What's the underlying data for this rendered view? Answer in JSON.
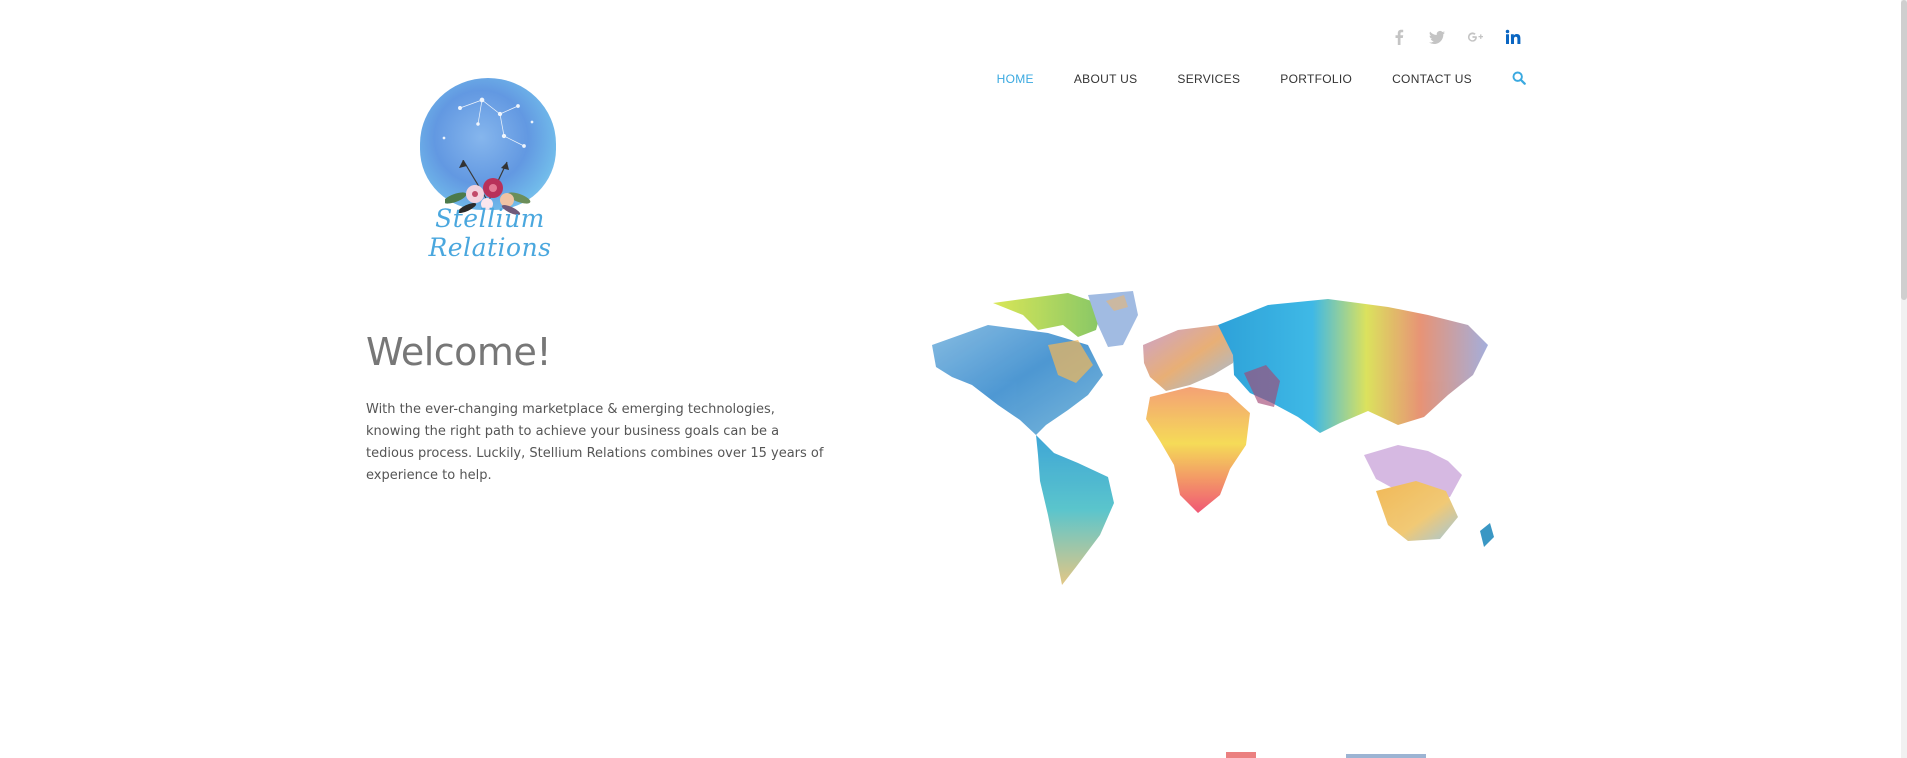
{
  "social": {
    "icons": [
      "facebook-icon",
      "twitter-icon",
      "google-plus-icon",
      "linkedin-icon"
    ],
    "linkedin_color": "#0a66c2",
    "muted_color": "#c4c4c4"
  },
  "nav": {
    "items": [
      {
        "label": "HOME",
        "active": true
      },
      {
        "label": "ABOUT US",
        "active": false
      },
      {
        "label": "SERVICES",
        "active": false
      },
      {
        "label": "PORTFOLIO",
        "active": false
      },
      {
        "label": "CONTACT US",
        "active": false
      }
    ],
    "accent_color": "#3aa9e0",
    "search_icon": "search-icon"
  },
  "logo": {
    "text": "Stellium Relations"
  },
  "hero": {
    "title": "Welcome!",
    "body": "With the ever-changing marketplace & emerging technologies, knowing the right path to achieve your business goals can be a tedious process. Luckily, Stellium Relations combines over 15 years of experience to help."
  }
}
